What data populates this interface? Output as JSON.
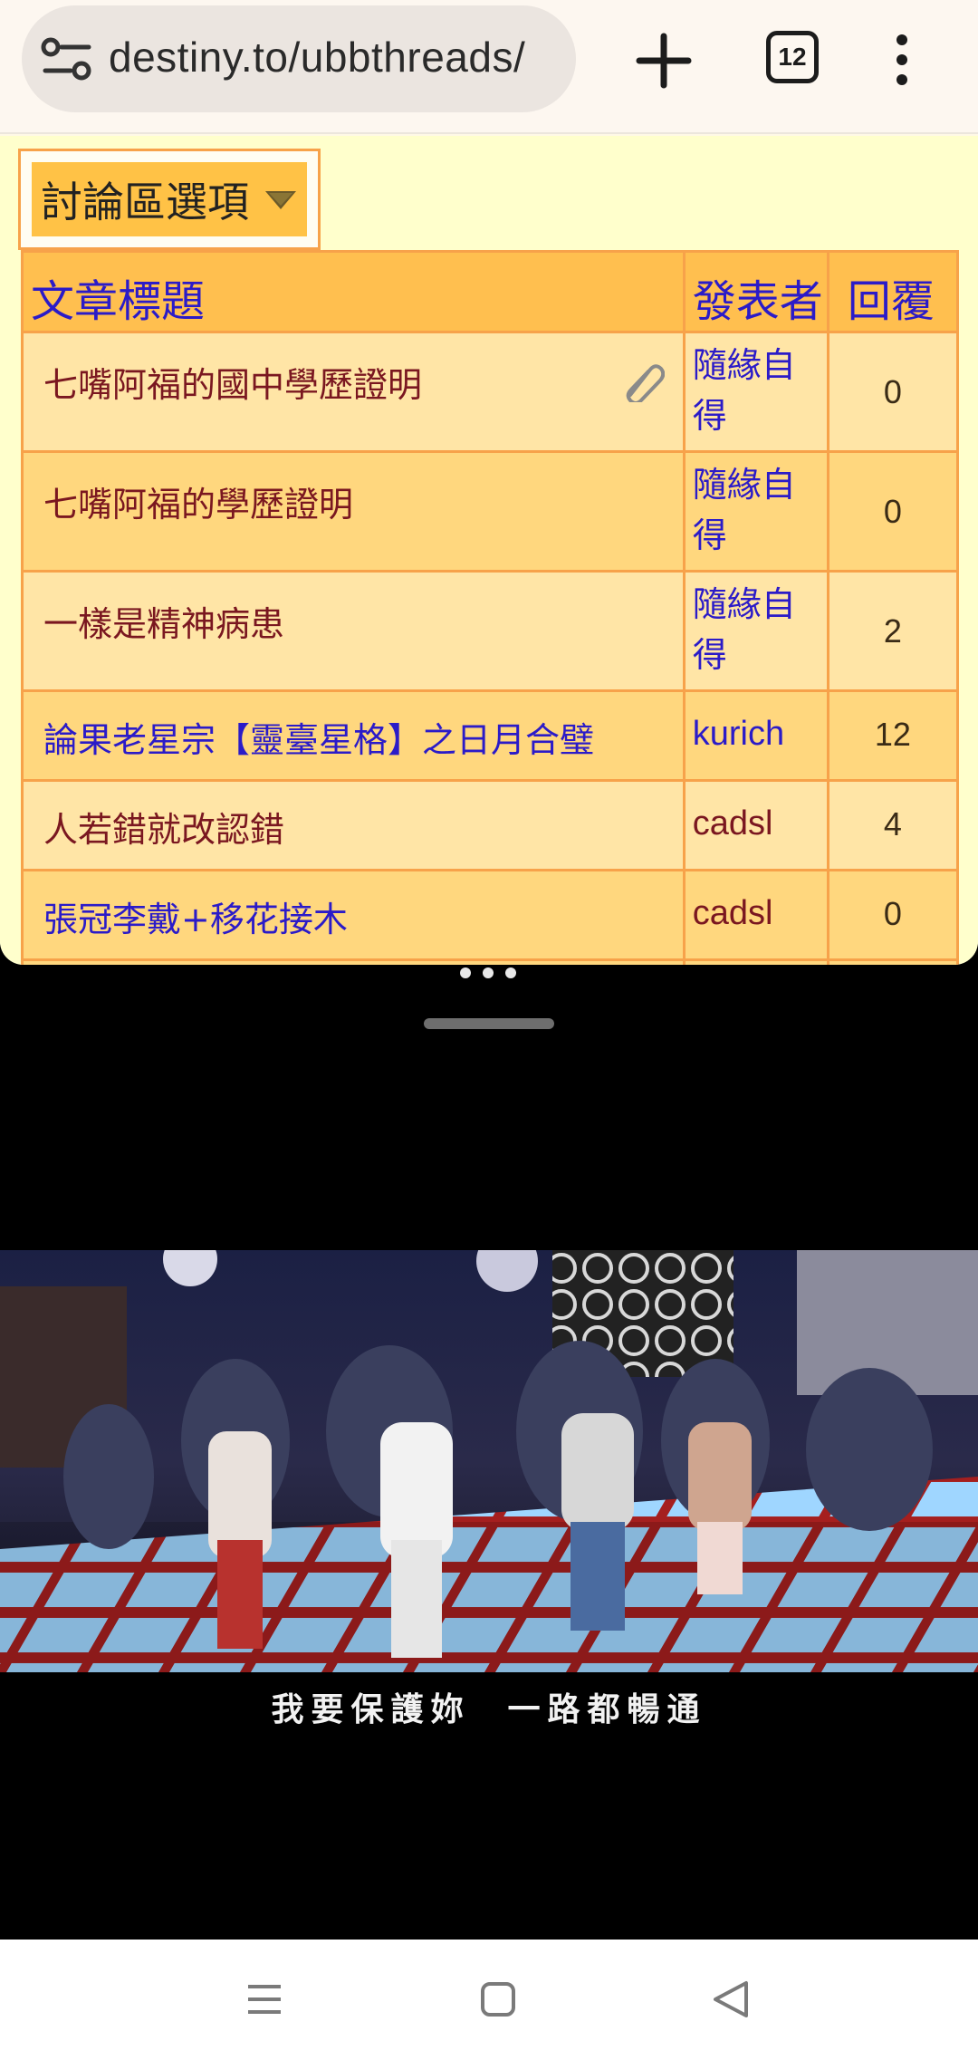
{
  "browser": {
    "url": "destiny.to/ubbthreads/",
    "tab_count": "12"
  },
  "forum": {
    "options_label": "討論區選項"
  },
  "table": {
    "headers": {
      "title": "文章標題",
      "author": "發表者",
      "replies": "回覆"
    },
    "rows": [
      {
        "title": "七嘴阿福的國中學歷證明",
        "author": "隨緣自得",
        "replies": "0",
        "has_attachment": true
      },
      {
        "title": "七嘴阿福的學歷證明",
        "author": "隨緣自得",
        "replies": "0"
      },
      {
        "title": "一樣是精神病患",
        "author": "隨緣自得",
        "replies": "2"
      },
      {
        "title": "論果老星宗【靈臺星格】之日月合璧",
        "author": "kurich",
        "replies": "12"
      },
      {
        "title": "人若錯就改認錯",
        "author": "cadsl",
        "replies": "4"
      },
      {
        "title": "張冠李戴+移花接木",
        "author": "cadsl",
        "replies": "0"
      }
    ]
  },
  "video": {
    "subtitle": "我要保護妳  一路都暢通"
  },
  "colors": {
    "header_link": "#2b1bc8",
    "title_visited": "#7a1720",
    "table_border": "#f7a24a",
    "row_light": "#ffe5a6",
    "row_dark": "#ffd77e"
  }
}
